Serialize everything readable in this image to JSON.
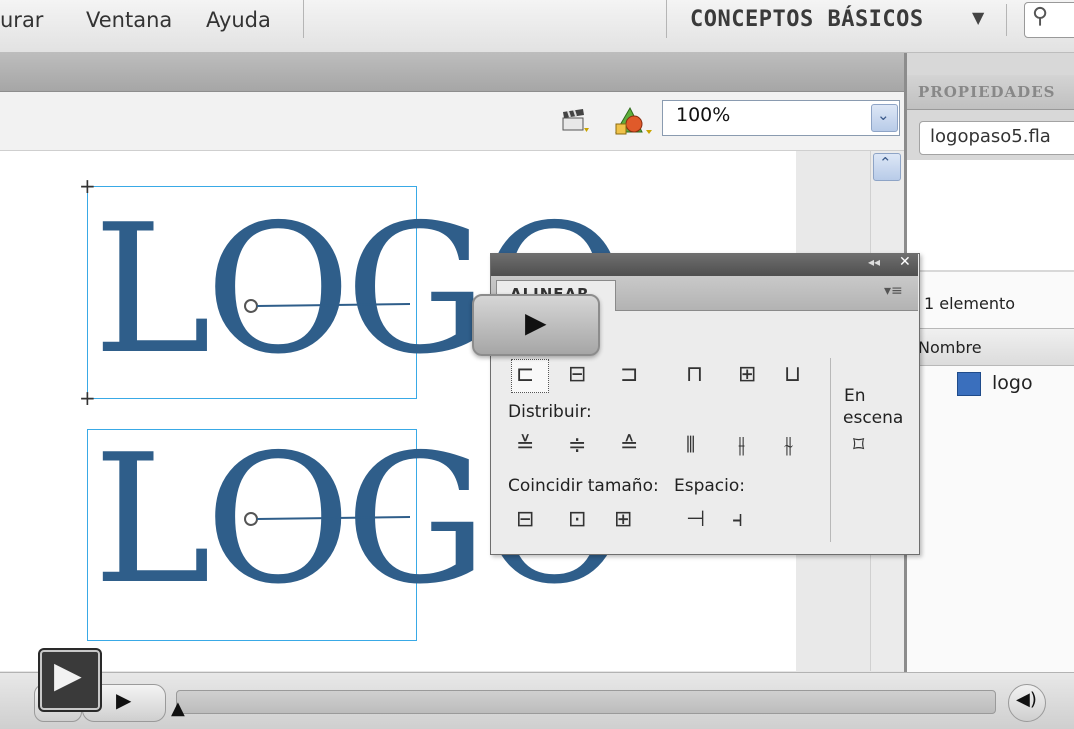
{
  "menu": {
    "items": [
      "urar",
      "Ventana",
      "Ayuda"
    ],
    "workspace": "CONCEPTOS BÁSICOS",
    "workspace_arrow": "▼",
    "search_icon": "search-icon"
  },
  "editbar": {
    "zoom": "100%",
    "zoom_dropdown_glyph": "⌄",
    "scroll_up_glyph": "⌃"
  },
  "stage": {
    "logo_top": "LOGO",
    "logo_bottom": "LOGO"
  },
  "properties": {
    "title": "PROPIEDADES",
    "file": "logopaso5.fla"
  },
  "library": {
    "count": "1 elemento",
    "column_name": "Nombre",
    "items": [
      "logo"
    ]
  },
  "align_panel": {
    "tab": "ALINEAR",
    "collapse_glyph": "◂◂",
    "close_glyph": "✕",
    "menu_glyph": "▾≡",
    "distribute_label": "Distribuir:",
    "match_size_label": "Coincidir tamaño:",
    "spacing_label": "Espacio:",
    "on_stage_line1": "En",
    "on_stage_line2": "escena"
  },
  "player": {
    "big_play_glyph": "▶",
    "play_glyph": "▶",
    "thumb_glyph": "▲",
    "volume_glyph": "◀)",
    "corner_play_glyph": "▶"
  }
}
